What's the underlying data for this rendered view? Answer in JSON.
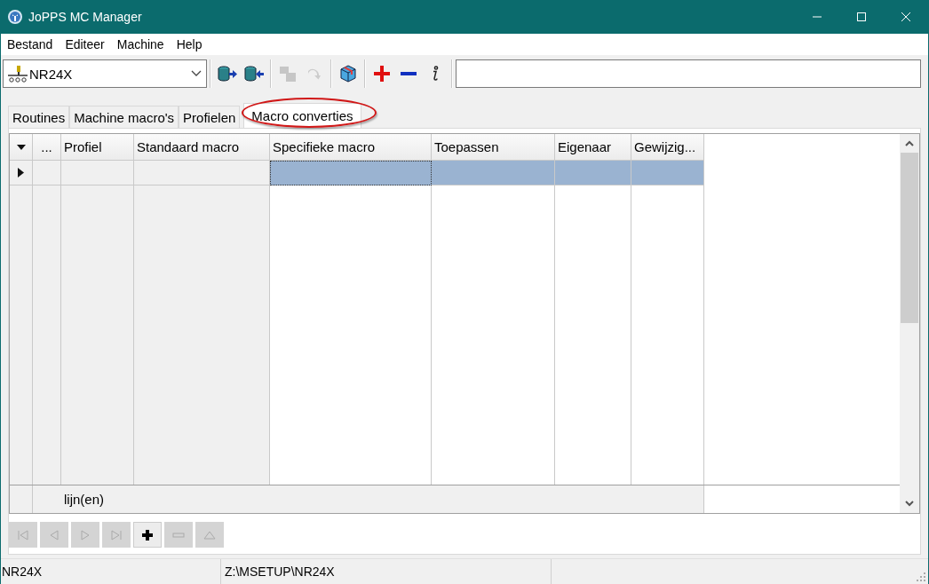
{
  "window": {
    "title": "JoPPS MC Manager"
  },
  "menu": [
    {
      "label": "Bestand"
    },
    {
      "label": "Editeer"
    },
    {
      "label": "Machine"
    },
    {
      "label": "Help"
    }
  ],
  "toolbar": {
    "machine_select": {
      "value": "NR24X"
    },
    "buttons": [
      {
        "disabled": false
      },
      {
        "disabled": false
      },
      {
        "disabled": true
      },
      {
        "disabled": true
      },
      {
        "disabled": false
      },
      {
        "disabled": false
      },
      {
        "disabled": false
      },
      {
        "disabled": false
      }
    ]
  },
  "tabs": [
    {
      "label": "Routines",
      "selected": false,
      "highlighted": false
    },
    {
      "label": "Machine macro's",
      "selected": false,
      "highlighted": false
    },
    {
      "label": "Profielen",
      "selected": false,
      "highlighted": false
    },
    {
      "label": "Macro converties",
      "selected": true,
      "highlighted": true
    }
  ],
  "table": {
    "columns": [
      {
        "label": "...",
        "readonly": true
      },
      {
        "label": "Profiel",
        "readonly": true
      },
      {
        "label": "Standaard macro",
        "readonly": true
      },
      {
        "label": "Specifieke macro",
        "readonly": false
      },
      {
        "label": "Toepassen",
        "readonly": false
      },
      {
        "label": "Eigenaar",
        "readonly": false
      },
      {
        "label": "Gewijzig...",
        "readonly": false
      }
    ],
    "rows": [
      {
        "current": true,
        "selected": true,
        "cells": [
          {
            "focused": false
          },
          {
            "focused": false
          },
          {
            "focused": false
          },
          {
            "focused": true
          },
          {
            "focused": false
          },
          {
            "focused": false
          },
          {
            "focused": false
          }
        ]
      }
    ],
    "footer": "lijn(en)"
  },
  "navigator": [
    {
      "disabled": true
    },
    {
      "disabled": true
    },
    {
      "disabled": true
    },
    {
      "disabled": true
    },
    {
      "disabled": false
    },
    {
      "disabled": true
    },
    {
      "disabled": true
    }
  ],
  "status_bar": [
    {
      "text": "NR24X"
    },
    {
      "text": "Z:\\MSETUP\\NR24X"
    }
  ]
}
